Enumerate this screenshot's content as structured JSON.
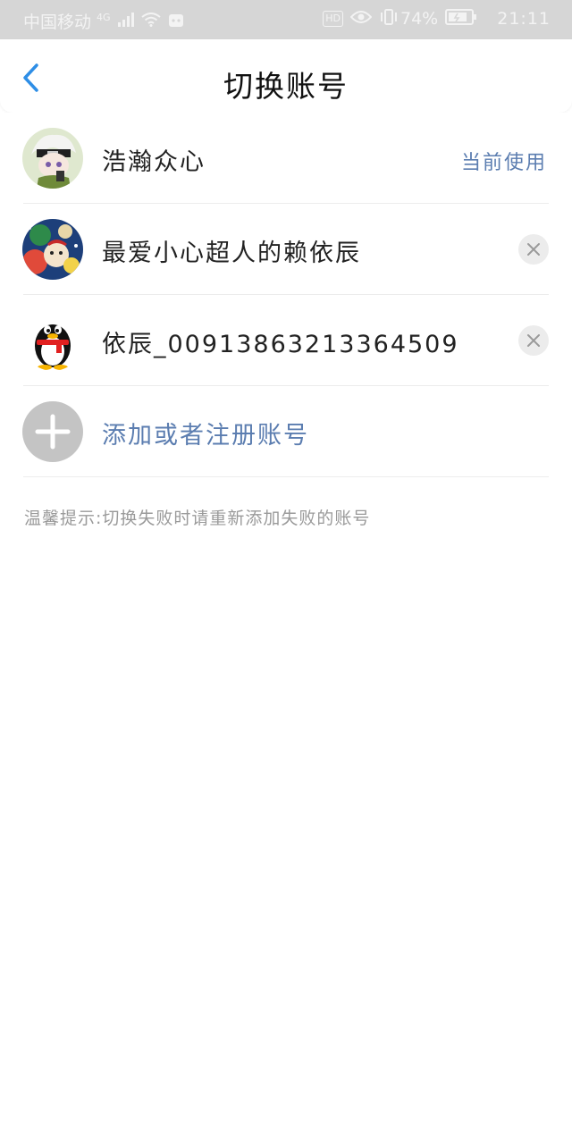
{
  "status_bar": {
    "carrier": "中国移动",
    "network": "4G",
    "battery": "74%",
    "time": "21:11",
    "hd_label": "HD"
  },
  "nav": {
    "title": "切换账号"
  },
  "accounts": [
    {
      "name": "浩瀚众心",
      "status": "当前使用"
    },
    {
      "name": "最爱小心超人的赖依辰"
    },
    {
      "name": "依辰_00913863213364509"
    }
  ],
  "add_account": {
    "label": "添加或者注册账号"
  },
  "tip": "温馨提示:切换失败时请重新添加失败的账号",
  "colors": {
    "accent": "#5b7db0",
    "back_arrow": "#2e8ee6",
    "status_bar_bg": "#d6d6d6",
    "divider": "#ececec"
  }
}
